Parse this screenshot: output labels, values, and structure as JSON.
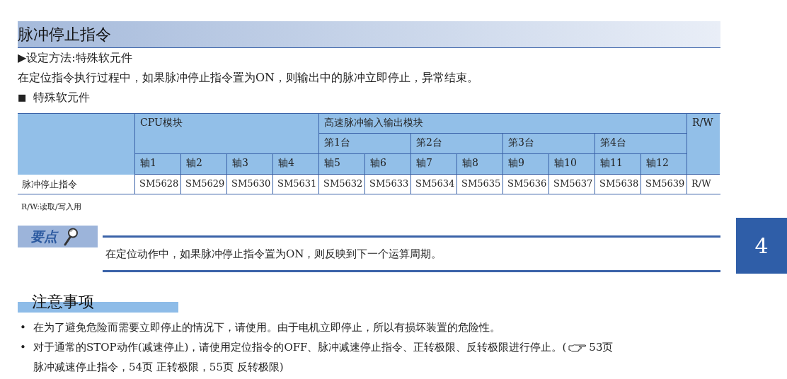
{
  "heading": "脉冲停止指令",
  "setting_method": "▶设定方法:特殊软元件",
  "description": "在定位指令执行过程中，如果脉冲停止指令置为ON，则输出中的脉冲立即停止，异常结束。",
  "subheading": {
    "marker": "■",
    "text": "特殊软元件"
  },
  "table": {
    "groups": [
      {
        "label": "CPU模块",
        "units": [
          {
            "axes": [
              "轴1",
              "轴2",
              "轴3",
              "轴4"
            ]
          }
        ]
      },
      {
        "label": "高速脉冲输入输出模块",
        "units": [
          {
            "label": "第1台",
            "axes": [
              "轴5",
              "轴6"
            ]
          },
          {
            "label": "第2台",
            "axes": [
              "轴7",
              "轴8"
            ]
          },
          {
            "label": "第3台",
            "axes": [
              "轴9",
              "轴10"
            ]
          },
          {
            "label": "第4台",
            "axes": [
              "轴11",
              "轴12"
            ]
          }
        ]
      }
    ],
    "rw_header": "R/W",
    "rows": [
      {
        "name": "脉冲停止指令",
        "cells": [
          "SM5628",
          "SM5629",
          "SM5630",
          "SM5631",
          "SM5632",
          "SM5633",
          "SM5634",
          "SM5635",
          "SM5636",
          "SM5637",
          "SM5638",
          "SM5639"
        ],
        "rw": "R/W"
      }
    ]
  },
  "table_note": "R/W:读取/写入用",
  "point": {
    "title": "要点",
    "text": "在定位动作中，如果脉冲停止指令置为ON，则反映到下一个运算周期。"
  },
  "caution": {
    "title": "注意事项",
    "items": [
      {
        "bullet": "•",
        "text": "在为了避免危险而需要立即停止的情况下，请使用。由于电机立即停止，所以有损坏装置的危险性。"
      },
      {
        "bullet": "•",
        "text": "对于通常的STOP动作(减速停止)，请使用定位指令的OFF、脉冲减速停止指令、正转极限、反转极限进行停止。(",
        "reference": "53页",
        "continuation": "脉冲减速停止指令，54页 正转极限，55页 反转极限)"
      }
    ]
  },
  "chapter_tab": "4"
}
